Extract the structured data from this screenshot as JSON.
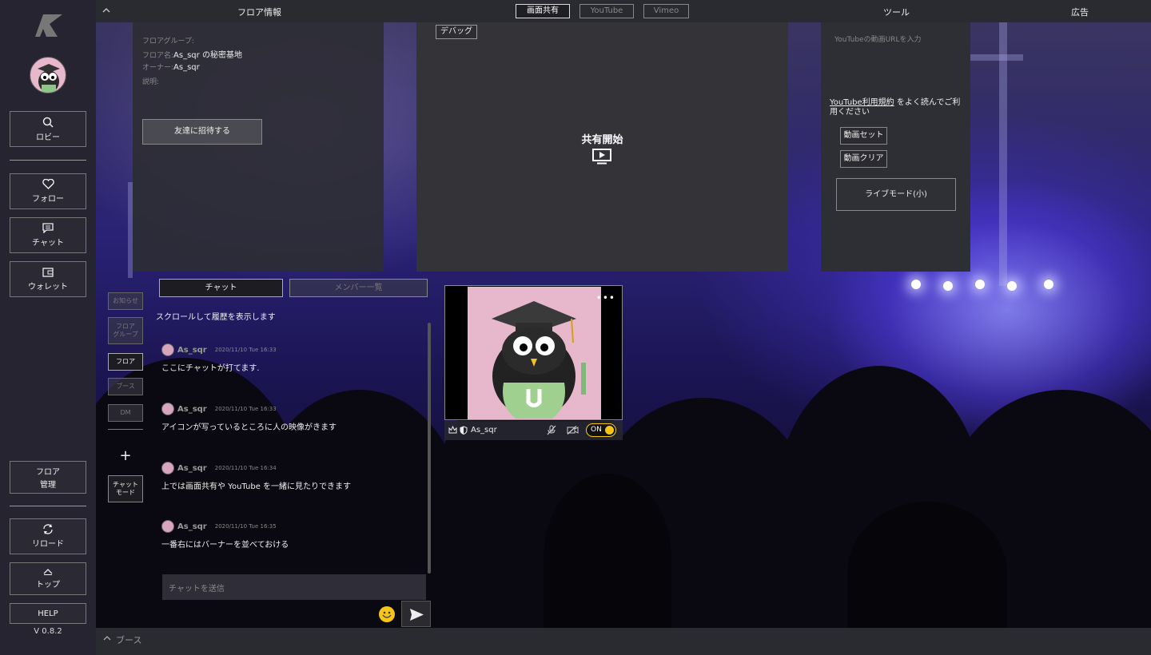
{
  "app": {
    "version": "V 0.8.2"
  },
  "sidebar": {
    "lobby": "ロビー",
    "follow": "フォロー",
    "chat": "チャット",
    "wallet": "ウォレット",
    "floor_manage_1": "フロア",
    "floor_manage_2": "管理",
    "reload": "リロード",
    "top": "トップ",
    "help": "HELP"
  },
  "topbar": {
    "floor_info": "フロア情報",
    "tabs": [
      "画面共有",
      "YouTube",
      "Vimeo"
    ],
    "tool": "ツール",
    "ad": "広告"
  },
  "floor_info": {
    "group_label": "フロアグループ:",
    "name_label": "フロア名:",
    "name_value": "As_sqr の秘密基地",
    "owner_label": "オーナー:",
    "owner_value": "As_sqr",
    "desc_label": "説明:",
    "invite_button": "友達に招待する"
  },
  "screen_share": {
    "debug_button": "デバッグ",
    "start_label": "共有開始"
  },
  "youtube": {
    "url_placeholder": "YouTubeの動画URLを入力",
    "terms_link": "YouTube利用規約",
    "terms_text": "をよく読んでご利用ください",
    "set_button": "動画セット",
    "clear_button": "動画クリア",
    "live_mode_button": "ライブモード(小)"
  },
  "chat_nav": {
    "notice": "お知らせ",
    "floor_group_1": "フロア",
    "floor_group_2": "グループ",
    "floor": "フロア",
    "booth": "ブース",
    "dm": "DM",
    "plus": "+",
    "chat_mode_1": "チャット",
    "chat_mode_2": "モード"
  },
  "chat": {
    "tab_chat": "チャット",
    "tab_members": "メンバー一覧",
    "scroll_hint": "スクロールして履歴を表示します",
    "messages": [
      {
        "user": "As_sqr",
        "time": "2020/11/10 Tue 16:33",
        "text": "ここにチャットが打てます."
      },
      {
        "user": "As_sqr",
        "time": "2020/11/10 Tue 16:33",
        "text": "アイコンが写っているところに人の映像がきます"
      },
      {
        "user": "As_sqr",
        "time": "2020/11/10 Tue 16:34",
        "text": "上では画面共有や YouTube を一緒に見たりできます"
      },
      {
        "user": "As_sqr",
        "time": "2020/11/10 Tue 16:35",
        "text": "一番右にはバーナーを並べておける"
      }
    ],
    "input_placeholder": "チャットを送信"
  },
  "video_tile": {
    "user": "As_sqr",
    "more": "•••",
    "toggle": "ON"
  },
  "bottombar": {
    "label": "ブース"
  },
  "colors": {
    "accent": "#f5c518",
    "panel": "#2e2e35"
  }
}
